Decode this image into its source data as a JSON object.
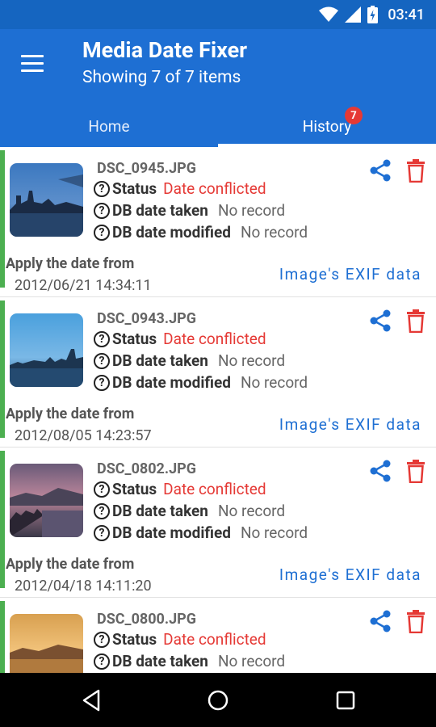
{
  "status_bar": {
    "time": "03:41"
  },
  "app": {
    "title": "Media Date Fixer",
    "subtitle": "Showing 7 of 7 items"
  },
  "tabs": [
    {
      "label": "Home",
      "active": false
    },
    {
      "label": "History",
      "active": true,
      "badge": "7"
    }
  ],
  "labels": {
    "status": "Status",
    "db_taken": "DB date taken",
    "db_modified": "DB date modified",
    "apply_from": "Apply the date from"
  },
  "items": [
    {
      "filename": "DSC_0945.JPG",
      "status": "Date conflicted",
      "db_taken": "No record",
      "db_modified": "No record",
      "apply_date": "2012/06/21 14:34:11",
      "source": "Image's EXIF data"
    },
    {
      "filename": "DSC_0943.JPG",
      "status": "Date conflicted",
      "db_taken": "No record",
      "db_modified": "No record",
      "apply_date": "2012/08/05 14:23:57",
      "source": "Image's EXIF data"
    },
    {
      "filename": "DSC_0802.JPG",
      "status": "Date conflicted",
      "db_taken": "No record",
      "db_modified": "No record",
      "apply_date": "2012/04/18 14:11:20",
      "source": "Image's EXIF data"
    },
    {
      "filename": "DSC_0800.JPG",
      "status": "Date conflicted",
      "db_taken": "No record",
      "db_modified": "",
      "apply_date": "",
      "source": ""
    }
  ],
  "colors": {
    "primary": "#1e6fd3",
    "status_bar": "#1565c0",
    "conflict": "#e53935",
    "accent_bar": "#4caf50"
  }
}
